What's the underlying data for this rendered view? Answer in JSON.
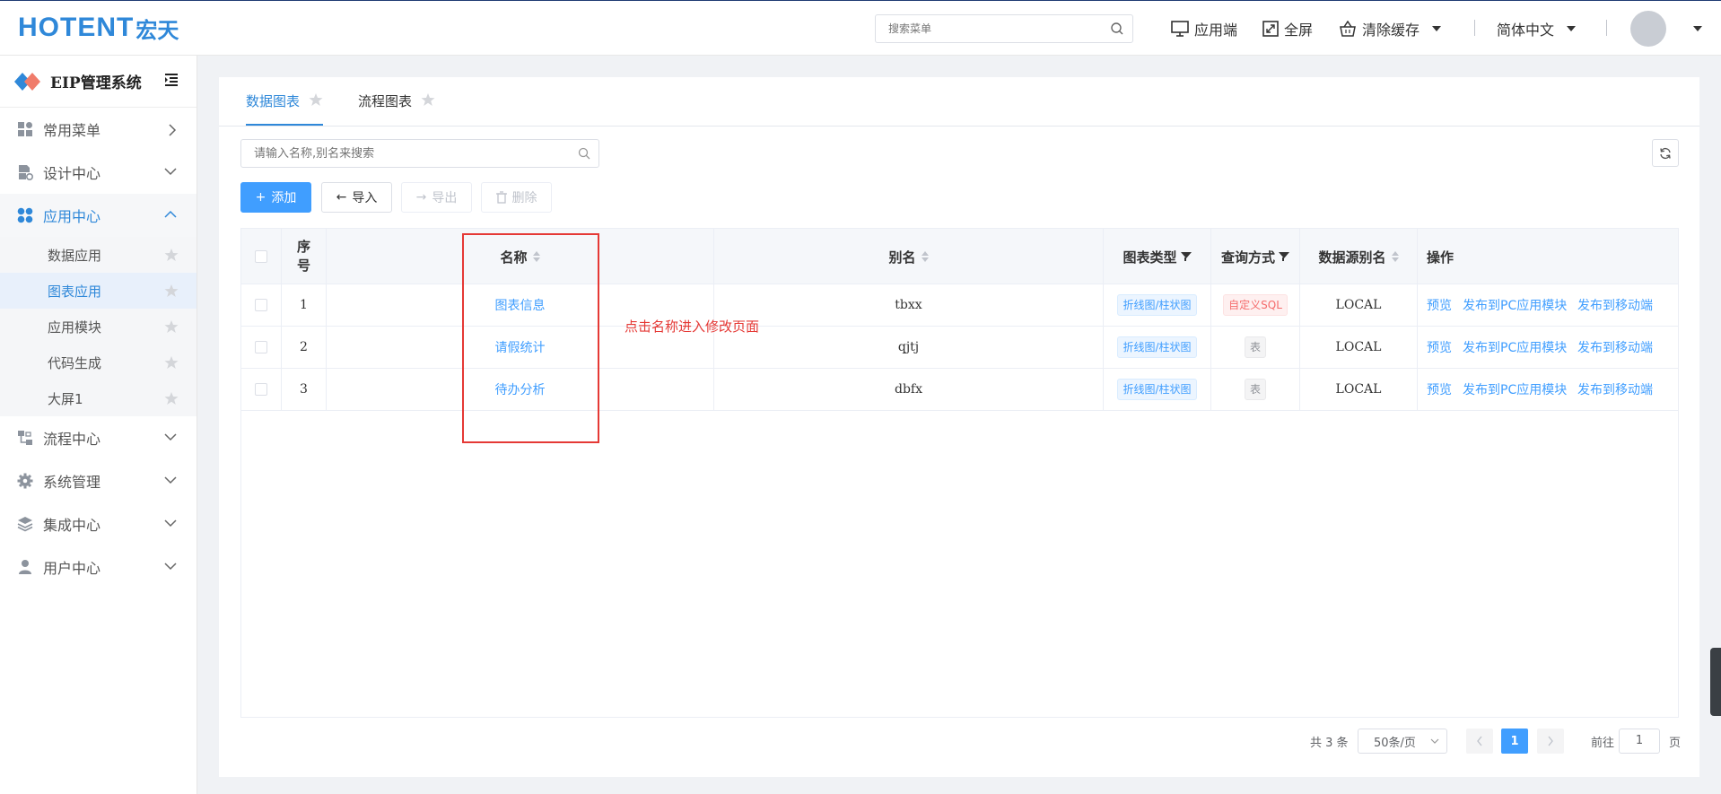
{
  "header": {
    "logo_text": "OTENT",
    "logo_letter": "H",
    "logo_cn": "宏天",
    "search_placeholder": "搜索菜单",
    "app_end": "应用端",
    "fullscreen": "全屏",
    "clear_cache": "清除缓存",
    "language": "简体中文"
  },
  "sidebar": {
    "title": "EIP管理系统",
    "menus": [
      {
        "label": "常用菜单"
      },
      {
        "label": "设计中心"
      },
      {
        "label": "应用中心"
      },
      {
        "label": "流程中心"
      },
      {
        "label": "系统管理"
      },
      {
        "label": "集成中心"
      },
      {
        "label": "用户中心"
      }
    ],
    "submenu": [
      {
        "label": "数据应用"
      },
      {
        "label": "图表应用"
      },
      {
        "label": "应用模块"
      },
      {
        "label": "代码生成"
      },
      {
        "label": "大屏1"
      }
    ]
  },
  "tabs": [
    {
      "label": "数据图表"
    },
    {
      "label": "流程图表"
    }
  ],
  "search": {
    "placeholder": "请输入名称,别名来搜索"
  },
  "toolbar": {
    "add": "添加",
    "import": "导入",
    "export": "导出",
    "delete": "删除"
  },
  "table": {
    "headers": {
      "index_1": "序",
      "index_2": "号",
      "name": "名称",
      "alias": "别名",
      "chart_type": "图表类型",
      "query_mode": "查询方式",
      "datasource": "数据源别名",
      "actions": "操作"
    },
    "rows": [
      {
        "index": "1",
        "name": "图表信息",
        "alias": "tbxx",
        "chart_type": "折线图/柱状图",
        "query_mode": "自定义SQL",
        "datasource": "LOCAL"
      },
      {
        "index": "2",
        "name": "请假统计",
        "alias": "qjtj",
        "chart_type": "折线图/柱状图",
        "query_mode": "表",
        "datasource": "LOCAL"
      },
      {
        "index": "3",
        "name": "待办分析",
        "alias": "dbfx",
        "chart_type": "折线图/柱状图",
        "query_mode": "表",
        "datasource": "LOCAL"
      }
    ],
    "actions": {
      "preview": "预览",
      "publish_pc": "发布到PC应用模块",
      "publish_mobile": "发布到移动端"
    }
  },
  "annotation": "点击名称进入修改页面",
  "pagination": {
    "total": "共 3 条",
    "page_size": "50条/页",
    "current": "1",
    "goto_label": "前往",
    "goto_value": "1",
    "page_unit": "页"
  },
  "colors": {
    "accent": "#409eff",
    "brand": "#2f88d9",
    "annotation": "#e53935"
  }
}
